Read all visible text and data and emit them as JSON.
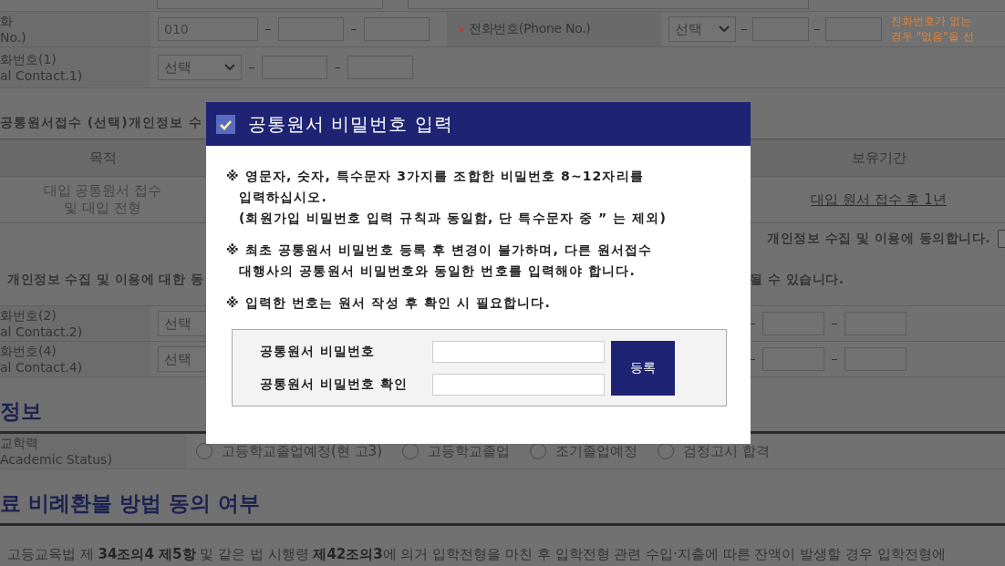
{
  "top_rows": [
    {
      "label": [
        "화",
        "No.)"
      ],
      "kind": "prefix",
      "prefix": "010",
      "right": {
        "label": "전화번호(Phone No.)",
        "required": true,
        "select": "선택",
        "note": [
          "전화번호가 없는",
          "경우 \"없음\"을 선"
        ]
      }
    },
    {
      "label": [
        "화번호(1)",
        "al Contact.1)"
      ],
      "kind": "select",
      "select": "선택"
    }
  ],
  "consent": {
    "heading": "공통원서접수 (선택)개인정보 수",
    "columns": [
      "목적",
      "보유기간"
    ],
    "row": [
      "대입 공통원서 접수\n및 대입 전형",
      "대입 원서 접수 후 1년"
    ],
    "agree_text": "개인정보 수집 및 이용에 동의합니다.",
    "agree_checked": false,
    "notice_left": "개인정보 수집 및 이용에 대한 동",
    "notice_right": "될 수 있습니다."
  },
  "contact_rows": [
    {
      "label": [
        "화번호(2)",
        "al Contact.2)"
      ],
      "select": "선택"
    },
    {
      "label": [
        "화번호(4)",
        "al Contact.4)"
      ],
      "select": "선택"
    }
  ],
  "education": {
    "heading": "정보",
    "label": [
      "교학력",
      "Academic Status)"
    ],
    "options": [
      {
        "label": "고등학교졸업예정(현 고3)",
        "selected": false
      },
      {
        "label": "고등학교졸업",
        "selected": false
      },
      {
        "label": "조기졸업예정",
        "selected": false
      },
      {
        "label": "검정고시 합격",
        "selected": false
      }
    ]
  },
  "refund": {
    "heading": "료 비례환불 방법 동의 여부",
    "text": "고등교육법 제 **34조의4 제5항** 및 같은 법 시행령 **제42조의3**에 의거 입학전형을 마친 후 입학전형 관련 수입·지출에 따른 잔액이 발생할 경우 입학전형에"
  },
  "modal": {
    "title": "공통원서 비밀번호 입력",
    "notes": [
      [
        "※ 영문자, 숫자, 특수문자 3가지를 조합한 비밀번호 8~12자리를",
        "입력하십시오.",
        "(회원가입 비밀번호 입력 규칙과 동일함, 단 특수문자 중 ” 는 제외)"
      ],
      [
        "※ 최초 공통원서 비밀번호 등록 후 변경이 불가하며, 다른 원서접수",
        "대행사의 공통원서 비밀번호와 동일한 번호를 입력해야 합니다."
      ],
      [
        "※ 입력한 번호는 원서 작성 후 확인 시 필요합니다."
      ]
    ],
    "fields": [
      {
        "label": "공통원서 비밀번호"
      },
      {
        "label": "공통원서 비밀번호 확인"
      }
    ],
    "submit": "등록"
  }
}
